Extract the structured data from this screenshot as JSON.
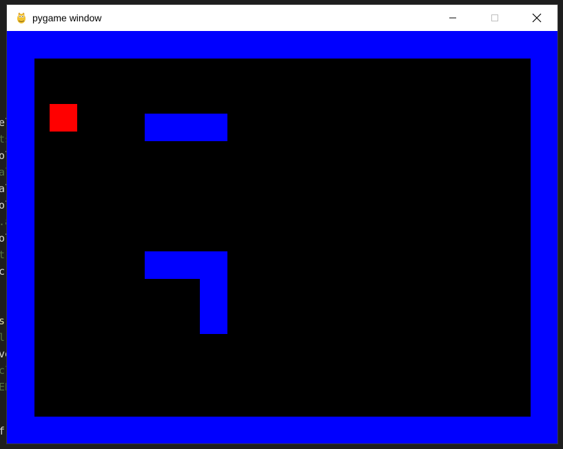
{
  "window": {
    "title": "pygame window",
    "controls": [
      "minimize",
      "maximize",
      "close"
    ]
  },
  "background_code": [
    {
      "text": "el",
      "style": "white"
    },
    {
      "text": "ts",
      "style": "dim"
    },
    {
      "text": "ol",
      "style": "white"
    },
    {
      "text": "al",
      "style": "dim"
    },
    {
      "text": "al",
      "style": "white"
    },
    {
      "text": "ol",
      "style": "white"
    },
    {
      "text": ".a",
      "style": "dim"
    },
    {
      "text": "ol",
      "style": "white"
    },
    {
      "text": "t",
      "style": "dim"
    },
    {
      "text": "cr",
      "style": "white"
    },
    {
      "text": "s(",
      "style": "yel"
    },
    {
      "text": "l",
      "style": "dim"
    },
    {
      "text": "ve",
      "style": "white"
    },
    {
      "text": "cl",
      "style": "dim"
    },
    {
      "text": "EB",
      "style": "dim"
    },
    {
      "text": "f",
      "style": "white"
    }
  ],
  "game": {
    "colors": {
      "wall": "#0000ff",
      "floor": "#000000",
      "food": "#ff0000"
    },
    "grid_cell_units": 20,
    "food": {
      "col": 1,
      "row": 3
    },
    "wall_segments": [
      {
        "col": 8,
        "row": 4,
        "cols": 6,
        "rows": 2
      },
      {
        "col": 8,
        "row": 14,
        "cols": 6,
        "rows": 2
      },
      {
        "col": 12,
        "row": 16,
        "cols": 2,
        "rows": 4
      }
    ]
  }
}
